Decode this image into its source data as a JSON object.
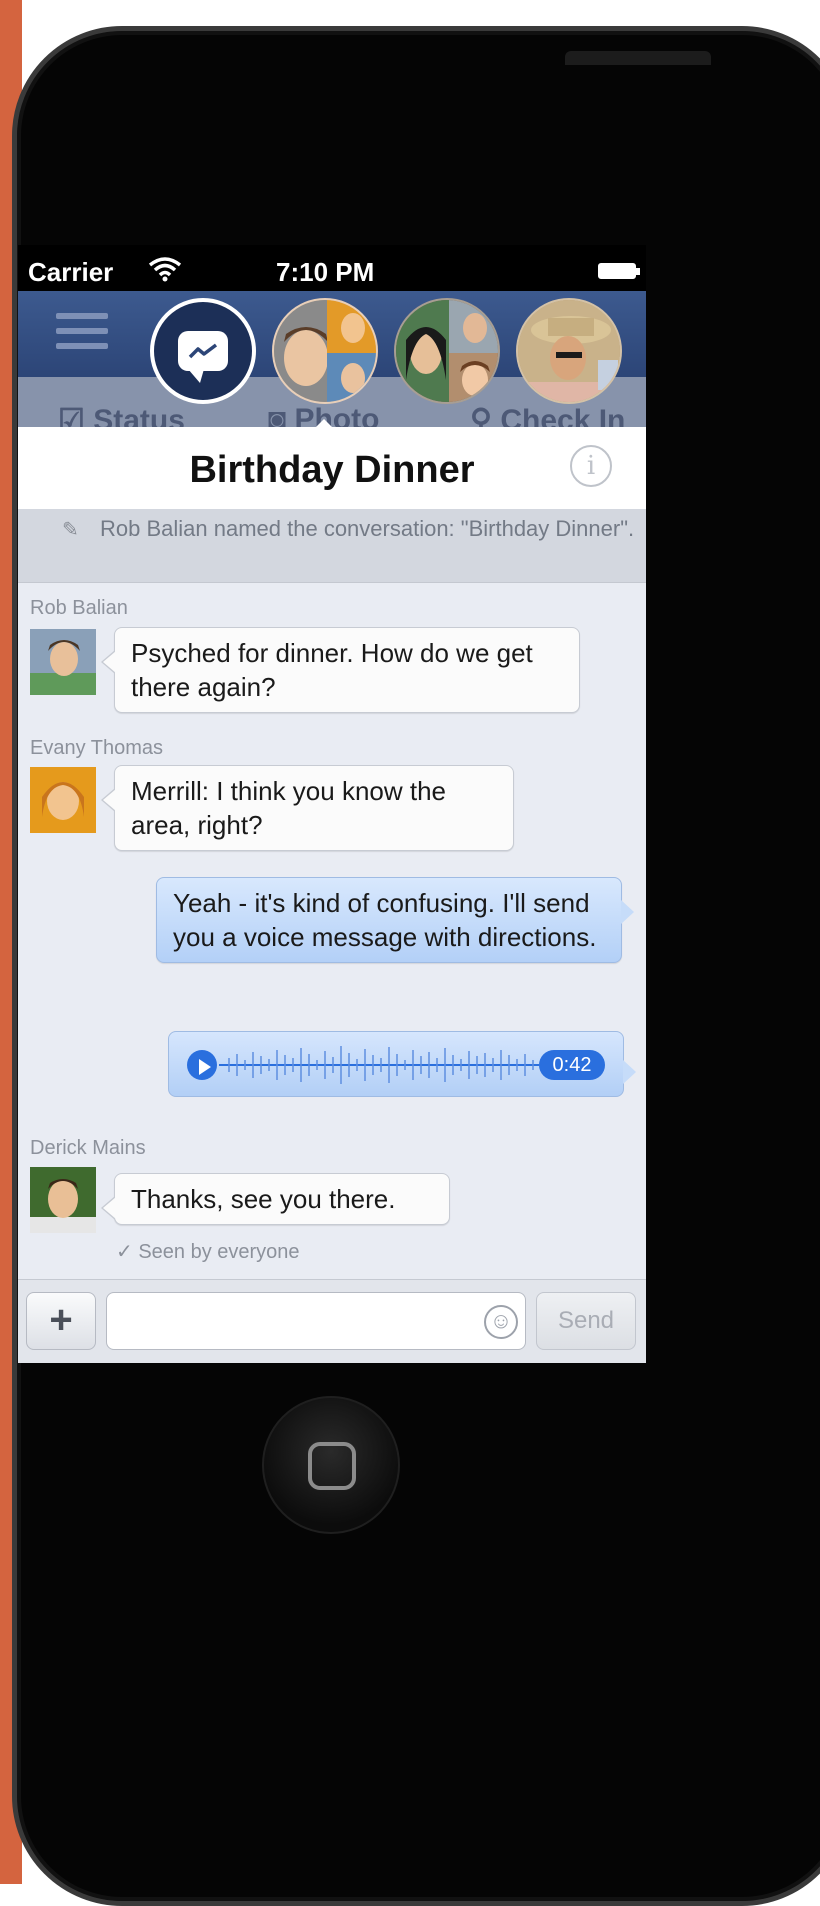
{
  "status_bar": {
    "carrier": "Carrier",
    "time": "7:10 PM"
  },
  "subbar": {
    "status": "Status",
    "photo": "Photo",
    "check_in": "Check In"
  },
  "conversation": {
    "title": "Birthday Dinner",
    "system_note": "Rob Balian named the conversation: \"Birthday Dinner\"."
  },
  "messages": [
    {
      "sender": "Rob Balian",
      "text": "Psyched for dinner. How do we get there again?"
    },
    {
      "sender": "Evany Thomas",
      "text": "Merrill: I think you know the area, right?"
    },
    {
      "sender": "",
      "text": "Yeah - it's kind of confusing. I'll send you a voice message with directions."
    },
    {
      "sender": "",
      "voice_duration": "0:42"
    },
    {
      "sender": "Derick Mains",
      "text": "Thanks, see you there."
    }
  ],
  "seen": "✓ Seen by everyone",
  "composer": {
    "plus": "+",
    "input_value": "",
    "input_placeholder": "",
    "send": "Send"
  },
  "colors": {
    "accent_blue": "#2a6fde",
    "navbar": "#3d5a8f",
    "brand_orange": "#d4643f"
  },
  "icons": {
    "menu": "hamburger-icon",
    "messenger": "messenger-icon",
    "wifi": "wifi-icon",
    "battery": "battery-icon",
    "info": "info-icon",
    "pencil": "pencil-icon",
    "play": "play-icon",
    "emoji": "emoji-icon"
  }
}
